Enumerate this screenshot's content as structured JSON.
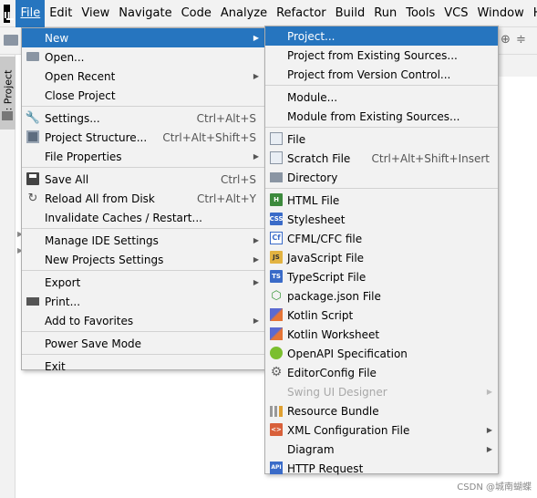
{
  "menubar": {
    "logo": "IJ",
    "items": [
      "File",
      "Edit",
      "View",
      "Navigate",
      "Code",
      "Analyze",
      "Refactor",
      "Build",
      "Run",
      "Tools",
      "VCS",
      "Window",
      "He"
    ],
    "active": "File"
  },
  "side_panel": {
    "tab_label": "1: Project"
  },
  "file_menu": {
    "new": "New",
    "open": "Open...",
    "open_recent": "Open Recent",
    "close_project": "Close Project",
    "settings": "Settings...",
    "settings_shortcut": "Ctrl+Alt+S",
    "project_structure": "Project Structure...",
    "project_structure_shortcut": "Ctrl+Alt+Shift+S",
    "file_properties": "File Properties",
    "save_all": "Save All",
    "save_all_shortcut": "Ctrl+S",
    "reload": "Reload All from Disk",
    "reload_shortcut": "Ctrl+Alt+Y",
    "invalidate": "Invalidate Caches / Restart...",
    "manage_ide": "Manage IDE Settings",
    "new_projects_settings": "New Projects Settings",
    "export": "Export",
    "print": "Print...",
    "add_favorites": "Add to Favorites",
    "power_save": "Power Save Mode",
    "exit": "Exit"
  },
  "new_menu": {
    "project": "Project...",
    "project_existing": "Project from Existing Sources...",
    "project_vcs": "Project from Version Control...",
    "module": "Module...",
    "module_existing": "Module from Existing Sources...",
    "file": "File",
    "scratch_file": "Scratch File",
    "scratch_shortcut": "Ctrl+Alt+Shift+Insert",
    "directory": "Directory",
    "html_file": "HTML File",
    "stylesheet": "Stylesheet",
    "cfml": "CFML/CFC file",
    "javascript": "JavaScript File",
    "typescript": "TypeScript File",
    "package_json": "package.json File",
    "kotlin_script": "Kotlin Script",
    "kotlin_worksheet": "Kotlin Worksheet",
    "openapi": "OpenAPI Specification",
    "editorconfig": "EditorConfig File",
    "swing": "Swing UI Designer",
    "resource_bundle": "Resource Bundle",
    "xml_config": "XML Configuration File",
    "diagram": "Diagram",
    "http_request": "HTTP Request"
  },
  "icon_badges": {
    "html": "H",
    "css": "CSS",
    "cfml": "Cf",
    "js": "JS",
    "ts": "TS",
    "api": "API",
    "xml": "<>"
  },
  "colors": {
    "highlight": "#2675bf",
    "menu_bg": "#f2f2f2",
    "disabled_text": "#a8a8a8"
  },
  "watermark": "CSDN @城南蝴蝶"
}
